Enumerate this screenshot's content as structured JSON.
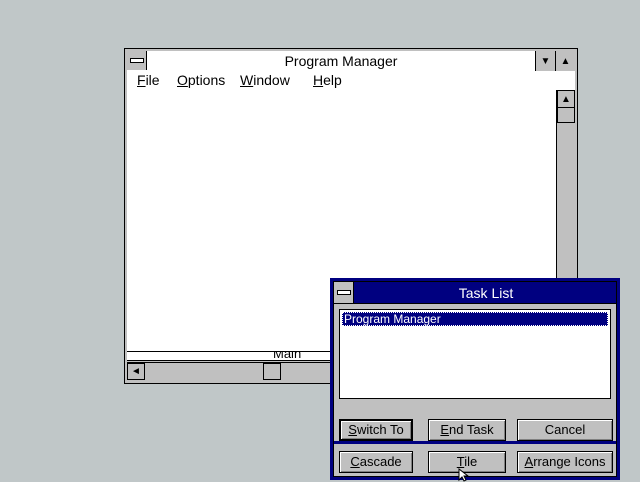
{
  "program_manager": {
    "title": "Program Manager",
    "menu": [
      {
        "prefix": "",
        "ul": "F",
        "rest": "ile"
      },
      {
        "prefix": "",
        "ul": "O",
        "rest": "ptions"
      },
      {
        "prefix": "",
        "ul": "W",
        "rest": "indow"
      },
      {
        "prefix": "",
        "ul": "H",
        "rest": "elp"
      }
    ],
    "minimized_group": "Main",
    "icons": {
      "minimize": "down-triangle-icon",
      "maximize": "up-triangle-icon",
      "scroll_up": "up-arrow-icon",
      "scroll_left": "left-arrow-icon"
    }
  },
  "task_list": {
    "title": "Task List",
    "items": [
      "Program Manager"
    ],
    "buttons_row1": [
      {
        "ul": "S",
        "rest": "witch To"
      },
      {
        "ul": "E",
        "rest": "nd Task"
      },
      {
        "ul": "",
        "rest": "Cancel"
      }
    ],
    "buttons_row2": [
      {
        "ul": "C",
        "rest": "ascade"
      },
      {
        "ul": "T",
        "rest": "ile"
      },
      {
        "ul": "A",
        "rest": "rrange Icons"
      }
    ]
  },
  "colors": {
    "desktop": "#c0c7c8",
    "active_title": "#000080",
    "window_face": "#c0c0c0"
  }
}
